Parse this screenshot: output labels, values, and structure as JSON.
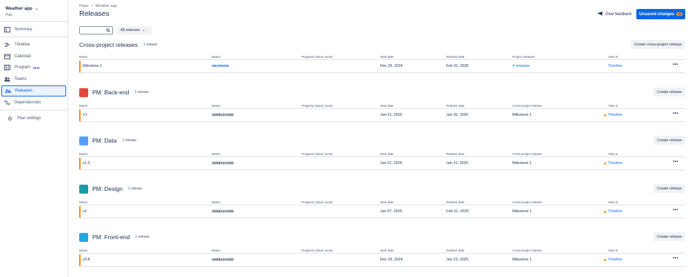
{
  "sidebar": {
    "app_title": "Weather app",
    "app_subtitle": "Plan",
    "items": [
      {
        "label": "Summary",
        "icon": "summary-icon"
      },
      {
        "label": "Timeline",
        "icon": "timeline-icon"
      },
      {
        "label": "Calendar",
        "icon": "calendar-icon"
      },
      {
        "label": "Program",
        "icon": "program-icon",
        "badge": "NEW"
      },
      {
        "label": "Teams",
        "icon": "teams-icon"
      },
      {
        "label": "Releases",
        "icon": "releases-icon",
        "active": true
      },
      {
        "label": "Dependencies",
        "icon": "dependencies-icon"
      },
      {
        "label": "Plan settings",
        "icon": "gear-icon"
      }
    ]
  },
  "header": {
    "breadcrumb": [
      "Plans",
      "/",
      "Weather app"
    ],
    "title": "Releases",
    "feedback_label": "Give feedback",
    "unsaved_label": "Unsaved changes",
    "unsaved_count": "10"
  },
  "filters": {
    "search_placeholder": "",
    "status_label": "All statuses"
  },
  "columns": {
    "name": "Name",
    "status": "Status",
    "progress": "Progress (issue count)",
    "start": "Start date",
    "release": "Release date",
    "project_releases": "Project releases",
    "cross_project_release": "Cross-project release",
    "view_in": "View in"
  },
  "sections": [
    {
      "title": "Cross-project releases",
      "count": "1 release",
      "button": "Create cross-project release",
      "row": {
        "name": "Milestone 1",
        "status": "ON-TRACK",
        "start": "Dec 29, 2024",
        "release": "Feb 01, 2025",
        "linked": "4 releases",
        "view": "Timeline"
      }
    },
    {
      "title": "PM: Back-end",
      "count": "1 release",
      "button": "Create release",
      "icon_color": "#e2483d",
      "row": {
        "name": "V1",
        "status": "UNRELEASED",
        "start": "Jan 01, 2025",
        "release": "Jan 30, 2025",
        "linked": "Milestone 1",
        "view": "Timeline"
      }
    },
    {
      "title": "PM: Data",
      "count": "1 release",
      "button": "Create release",
      "icon_color": "#579dff",
      "row": {
        "name": "v1.3",
        "status": "UNRELEASED",
        "start": "Jan 01, 2025",
        "release": "Jan 31, 2025",
        "linked": "Milestone 1",
        "view": "Timeline"
      }
    },
    {
      "title": "PM: Design",
      "count": "1 release",
      "button": "Create release",
      "icon_color": "#1d9aaa",
      "row": {
        "name": "v2",
        "status": "UNRELEASED",
        "start": "Jan 07, 2025",
        "release": "Feb 01, 2025",
        "linked": "Milestone 1",
        "view": "Timeline"
      }
    },
    {
      "title": "PM: Front-end",
      "count": "1 release",
      "button": "Create release",
      "icon_color": "#22a8e0",
      "row": {
        "name": "v3.8",
        "status": "UNRELEASED",
        "start": "Dec 29, 2024",
        "release": "Jan 23, 2025",
        "linked": "Milestone 1",
        "view": "Timeline"
      }
    }
  ],
  "colors": {
    "accent": "#0c66e4",
    "release_bar": "#f18d13",
    "count_badge": "#fca700"
  }
}
